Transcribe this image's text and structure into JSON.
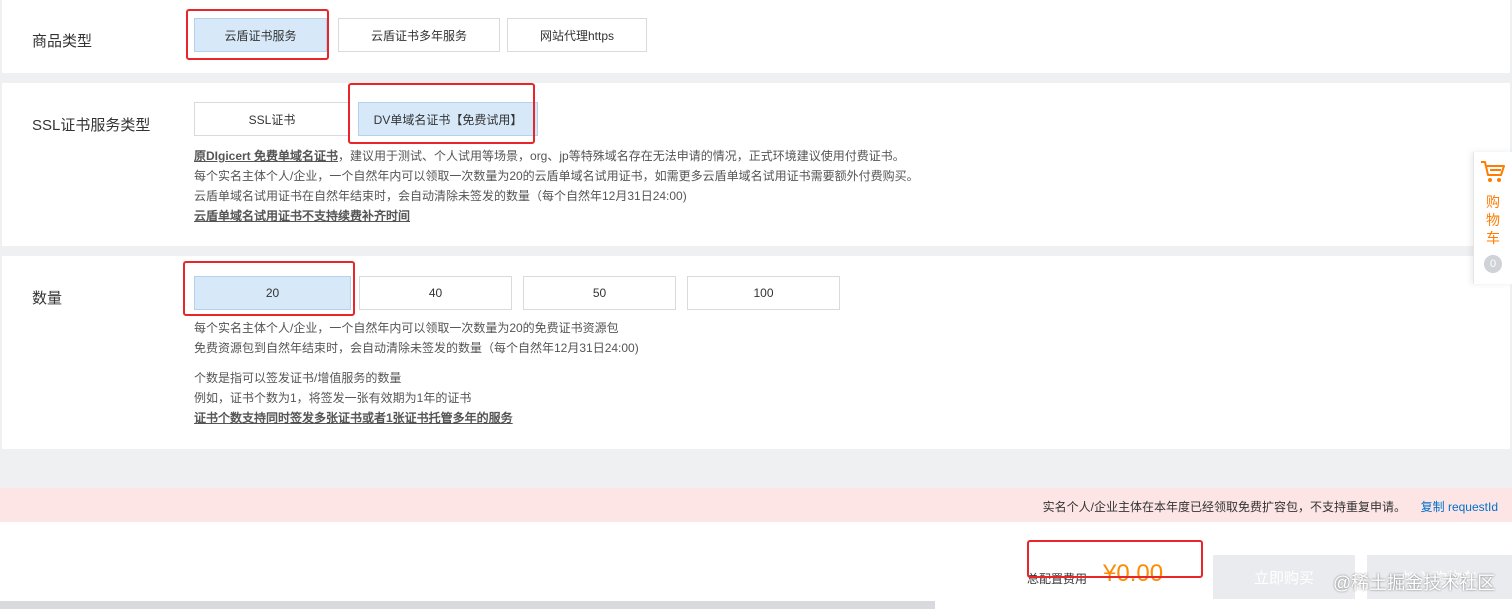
{
  "product_type": {
    "label": "商品类型",
    "options": [
      "云盾证书服务",
      "云盾证书多年服务",
      "网站代理https"
    ],
    "selected": 0
  },
  "ssl_type": {
    "label": "SSL证书服务类型",
    "options": [
      "SSL证书",
      "DV单域名证书【免费试用】"
    ],
    "selected": 1,
    "desc_line1_bold": "原DIgicert 免费单域名证书",
    "desc_line1_rest": "，建议用于测试、个人试用等场景，org、jp等特殊域名存在无法申请的情况，正式环境建议使用付费证书。",
    "desc_line2": "每个实名主体个人/企业，一个自然年内可以领取一次数量为20的云盾单域名试用证书，如需更多云盾单域名试用证书需要额外付费购买。",
    "desc_line3": "云盾单域名试用证书在自然年结束时，会自动清除未签发的数量（每个自然年12月31日24:00)",
    "desc_line4_bold": "云盾单域名试用证书不支持续费补齐时间"
  },
  "quantity": {
    "label": "数量",
    "options": [
      "20",
      "40",
      "50",
      "100"
    ],
    "selected": 0,
    "desc_line1": "每个实名主体个人/企业，一个自然年内可以领取一次数量为20的免费证书资源包",
    "desc_line2": "免费资源包到自然年结束时，会自动清除未签发的数量（每个自然年12月31日24:00)",
    "desc_line3": "个数是指可以签发证书/增值服务的数量",
    "desc_line4": "例如，证书个数为1，将签发一张有效期为1年的证书",
    "desc_line5_bold": "证书个数支持同时签发多张证书或者1张证书托管多年的服务"
  },
  "cart": {
    "label": "购物车",
    "count": "0",
    "icon": "shopping-cart-icon"
  },
  "warning": {
    "text": "实名个人/企业主体在本年度已经领取免费扩容包，不支持重复申请。",
    "link": "复制 requestId"
  },
  "footer": {
    "fee_label": "总配置费用",
    "fee_value": "¥0.00",
    "buy_now": "立即购买",
    "add_to_cart": "加入购物车",
    "watermark": "@稀土掘金技术社区"
  },
  "colors": {
    "selected_bg": "#d7e9f8",
    "highlight_red": "#e8262a",
    "price_orange": "#ff8a00",
    "link_blue": "#0070cc"
  }
}
